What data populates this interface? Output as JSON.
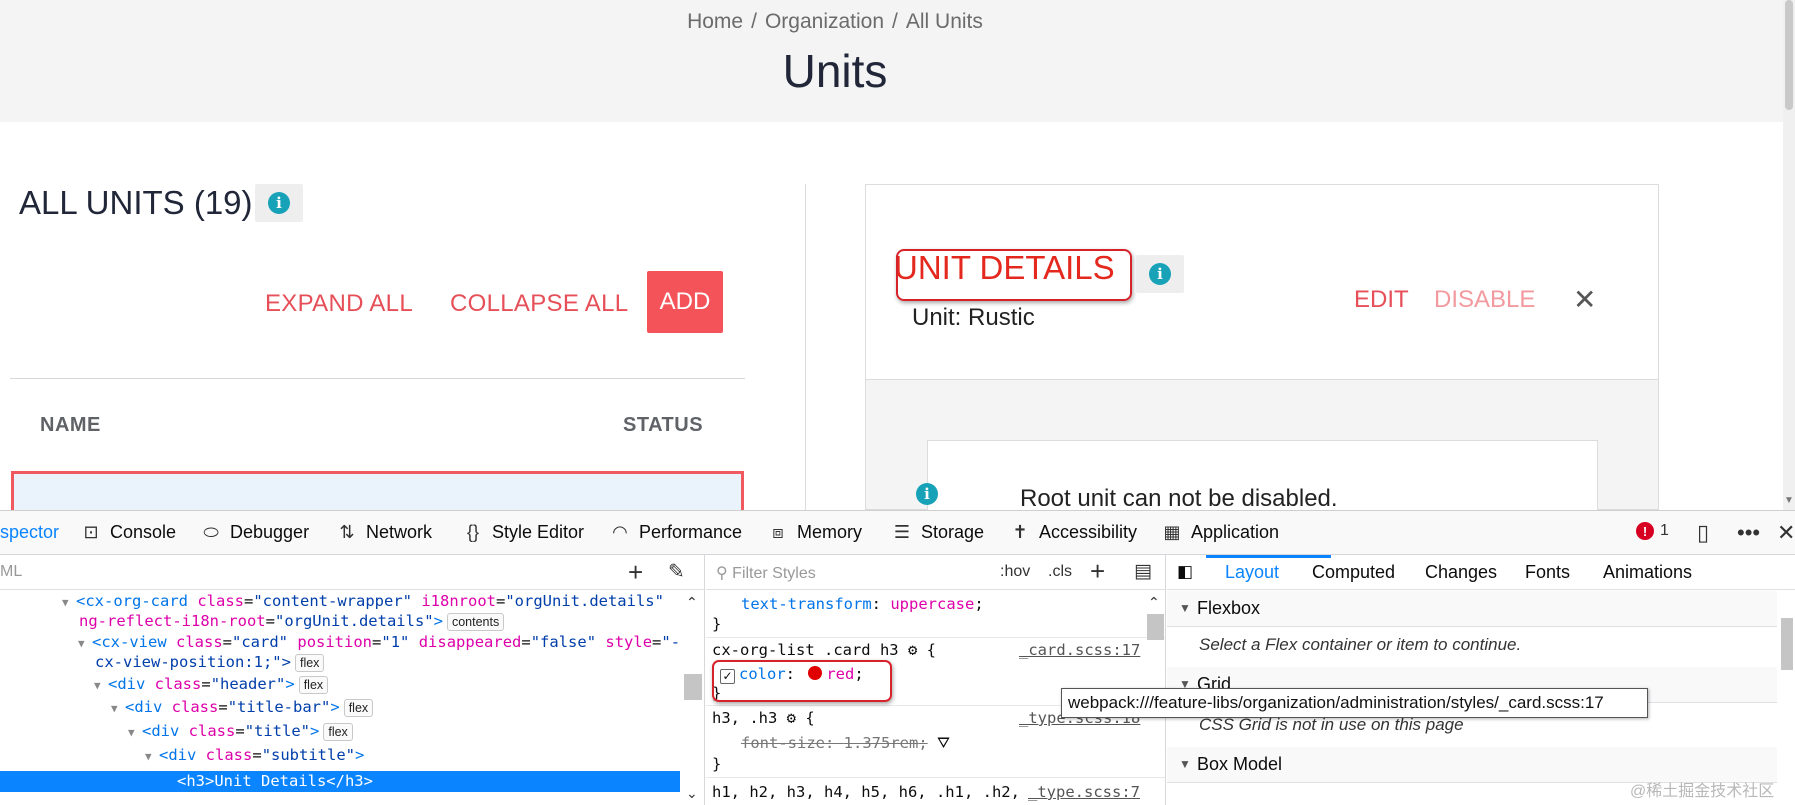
{
  "page": {
    "breadcrumb": [
      "Home",
      "Organization",
      "All Units"
    ],
    "breadcrumb_sep": "/",
    "title": "Units"
  },
  "units_list": {
    "title": "ALL UNITS (19)",
    "info_glyph": "i",
    "expand_all": "EXPAND ALL",
    "collapse_all": "COLLAPSE ALL",
    "add": "ADD",
    "columns": [
      "NAME",
      "STATUS"
    ]
  },
  "details_card": {
    "title": "UNIT DETAILS",
    "subtitle": "Unit: Rustic",
    "edit": "EDIT",
    "disable": "DISABLE",
    "close_glyph": "✕",
    "notice": "Root unit can not be disabled."
  },
  "devtools": {
    "tabs": [
      {
        "label": "spector",
        "icon": "inspector-icon"
      },
      {
        "label": "Console",
        "icon": "console-icon"
      },
      {
        "label": "Debugger",
        "icon": "debugger-icon"
      },
      {
        "label": "Network",
        "icon": "network-icon"
      },
      {
        "label": "Style Editor",
        "icon": "style-editor-icon"
      },
      {
        "label": "Performance",
        "icon": "performance-icon"
      },
      {
        "label": "Memory",
        "icon": "memory-icon"
      },
      {
        "label": "Storage",
        "icon": "storage-icon"
      },
      {
        "label": "Accessibility",
        "icon": "accessibility-icon"
      },
      {
        "label": "Application",
        "icon": "application-icon"
      }
    ],
    "error_count": "1",
    "html_search_label": "ML",
    "html_tree": {
      "l1": {
        "tag": "<cx-org-card",
        "a1": "class",
        "v1": "\"content-wrapper\"",
        "a2": "i18nroot",
        "v2": "\"orgUnit.details\""
      },
      "l2": {
        "a1": "ng-reflect-i18n-root",
        "v1": "\"orgUnit.details\"",
        "close": ">",
        "badge": "contents"
      },
      "l3": {
        "tag": "<cx-view",
        "a1": "class",
        "v1": "\"card\"",
        "a2": "position",
        "v2": "\"1\"",
        "a3": "disappeared",
        "v3": "\"false\"",
        "a4": "style",
        "v4": "\"--"
      },
      "l4": {
        "text": "cx-view-position:1;\">",
        "badge": "flex"
      },
      "l5": {
        "tag": "<div",
        "a1": "class",
        "v1": "\"header\"",
        "close": ">",
        "badge": "flex"
      },
      "l6": {
        "tag": "<div",
        "a1": "class",
        "v1": "\"title-bar\"",
        "close": ">",
        "badge": "flex"
      },
      "l7": {
        "tag": "<div",
        "a1": "class",
        "v1": "\"title\"",
        "close": ">",
        "badge": "flex"
      },
      "l8": {
        "tag": "<div",
        "a1": "class",
        "v1": "\"subtitle\"",
        "close": ">"
      },
      "l9": {
        "text": "<h3>Unit Details</h3>"
      }
    },
    "rules": {
      "filter_placeholder": "Filter Styles",
      "hov": ":hov",
      "cls": ".cls",
      "r0_prop": "text-transform",
      "r0_val": "uppercase",
      "r1_selector": "cx-org-list .card h3",
      "r1_source": "_card.scss:17",
      "r1_prop": "color",
      "r1_val": "red",
      "r2_selector": "h3, .h3",
      "r2_source": "_type.scss:18",
      "r2_prop": "font-size",
      "r2_val": "1.375rem",
      "r3_selector": "h1, h2, h3, h4, h5, h6, .h1, .h2,",
      "r3_source": "_type.scss:7",
      "brace_open": "{",
      "brace_close": "}"
    },
    "layout": {
      "tabs": [
        "Layout",
        "Computed",
        "Changes",
        "Fonts",
        "Animations"
      ],
      "flexbox_title": "Flexbox",
      "flexbox_msg": "Select a Flex container or item to continue.",
      "grid_title": "Grid",
      "grid_msg": "CSS Grid is not in use on this page",
      "boxmodel_title": "Box Model"
    },
    "tooltip": "webpack:///feature-libs/organization/administration/styles/_card.scss:17"
  },
  "watermark": "@稀土掘金技术社区",
  "colors": {
    "accent_red": "#e74f58",
    "add_button": "#f5535a",
    "info_teal": "#17a2b8",
    "devtools_blue": "#0a84ff",
    "highlight_red": "#d6232a"
  }
}
